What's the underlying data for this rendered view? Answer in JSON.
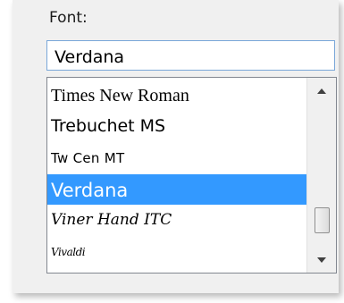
{
  "font": {
    "label": "Font:",
    "value": "Verdana",
    "items": [
      "Times New Roman",
      "Trebuchet MS",
      "Tw Cen MT",
      "Verdana",
      "Viner Hand ITC",
      "Vivaldi"
    ],
    "selected": "Verdana"
  },
  "colors": {
    "selection": "#3399ff",
    "input_border": "#7aa7d9",
    "panel_bg": "#f0f0f0"
  },
  "icons": {
    "scroll_up": "scroll-up-arrow-icon",
    "scroll_down": "scroll-down-arrow-icon"
  }
}
